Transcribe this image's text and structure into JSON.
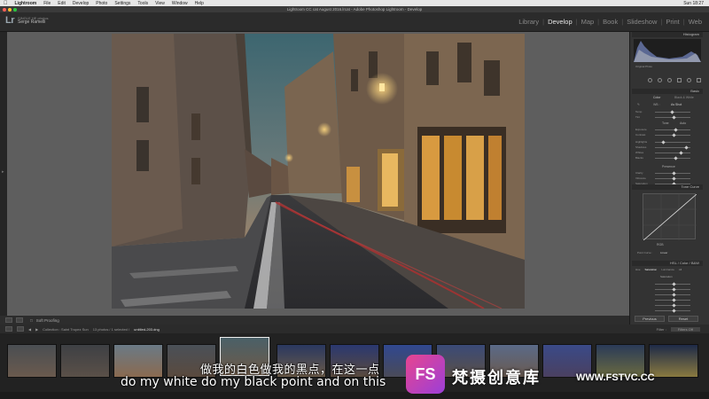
{
  "menubar": {
    "app": "Lightroom",
    "items": [
      "File",
      "Edit",
      "Develop",
      "Photo",
      "Settings",
      "Tools",
      "View",
      "Window",
      "Help"
    ],
    "clock": "Sun 18:27"
  },
  "window": {
    "title": "Lightroom CC cat August 2016.lrcat - Adobe Photoshop Lightroom - Develop"
  },
  "identity": {
    "line1": "SINGLE HE photos",
    "line2": "Serge Ramelli",
    "logo": "Lr"
  },
  "modules": {
    "items": [
      "Library",
      "Develop",
      "Map",
      "Book",
      "Slideshow",
      "Print",
      "Web"
    ],
    "active": "Develop"
  },
  "toolbar": {
    "soft_proofing": "Soft Proofing"
  },
  "right_panel": {
    "histogram": "Histogram",
    "original_photo": "Original Photo",
    "basic": "Basic",
    "treatment_color": "Color",
    "treatment_bw": "Black & White",
    "wb_label": "WB :",
    "wb_value": "As Shot",
    "temp": "Temp",
    "tint": "Tint",
    "tone": "Tone",
    "tone_auto": "Auto",
    "exposure": "Exposure",
    "contrast": "Contrast",
    "highlights": "Highlights",
    "shadows": "Shadows",
    "whites": "Whites",
    "blacks": "Blacks",
    "presence": "Presence",
    "clarity": "Clarity",
    "vibrance": "Vibrance",
    "saturation": "Saturation",
    "tone_curve": "Tone Curve",
    "channel": "RGB",
    "point_curve": "Point Curve :",
    "point_curve_value": "Linear",
    "hsl": "HSL / Color / B&W",
    "hsl_tabs": [
      "Hue",
      "Saturation",
      "Luminance",
      "All"
    ],
    "hsl_section": "Saturation",
    "previous_btn": "Previous",
    "reset_btn": "Reset"
  },
  "filmstrip": {
    "source": "Collection : Saint Tropez Sun",
    "count": "13 photos / 1 selected /",
    "filename": "untitled-203.dng",
    "filter_label": "Filter :",
    "filter_value": "Filters Off"
  },
  "subtitles": {
    "zh": "做我的白色做我的黑点，在这一点",
    "en": "do my white do my black point and on this"
  },
  "watermark": {
    "logo": "FS",
    "text": "梵摄创意库",
    "url": "WWW.FSTVC.CC"
  },
  "colors": {
    "accent_logo": "#e8458f",
    "panel_bg": "#333333",
    "workspace_bg": "#5e5e5e"
  }
}
